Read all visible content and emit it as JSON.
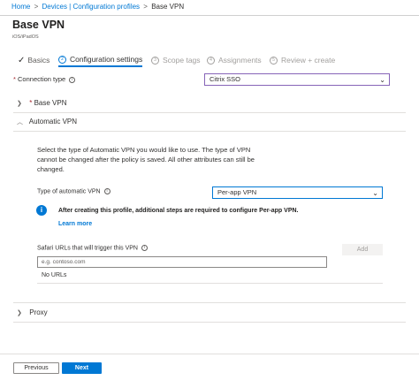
{
  "breadcrumb": {
    "items": [
      "Home",
      "Devices | Configuration profiles",
      "Base VPN"
    ],
    "separator": ">"
  },
  "page": {
    "title": "Base VPN",
    "subtitle": "iOS/iPadOS"
  },
  "steps": [
    {
      "label": "Basics",
      "state": "completed",
      "icon": "checkmark-icon"
    },
    {
      "number": "2",
      "label": "Configuration settings",
      "state": "active"
    },
    {
      "number": "3",
      "label": "Scope tags",
      "state": "inactive"
    },
    {
      "number": "4",
      "label": "Assignments",
      "state": "inactive"
    },
    {
      "number": "5",
      "label": "Review + create",
      "state": "inactive"
    }
  ],
  "connection_type": {
    "required_marker": "*",
    "label": "Connection type",
    "value": "Citrix SSO"
  },
  "sections": {
    "base_vpn": {
      "required_marker": "*",
      "label": "Base VPN",
      "expanded": false
    },
    "automatic_vpn": {
      "label": "Automatic VPN",
      "expanded": true
    },
    "proxy": {
      "label": "Proxy",
      "expanded": false
    }
  },
  "automatic_vpn": {
    "description": "Select the type of Automatic VPN you would like to use. The type of VPN cannot be changed after the policy is saved. All other attributes can still be changed.",
    "type_label": "Type of automatic VPN",
    "type_value": "Per-app VPN",
    "info_message": "After creating this profile, additional steps are required to configure Per-app VPN.",
    "learn_more": "Learn more",
    "safari_label": "Safari URLs that will trigger this VPN",
    "add_button": "Add",
    "safari_placeholder": "e.g. contoso.com",
    "empty_list": "No URLs"
  },
  "footer": {
    "previous": "Previous",
    "next": "Next"
  },
  "colors": {
    "accent": "#0078d4",
    "required": "#a4262c",
    "focus_border": "#8764b8"
  }
}
